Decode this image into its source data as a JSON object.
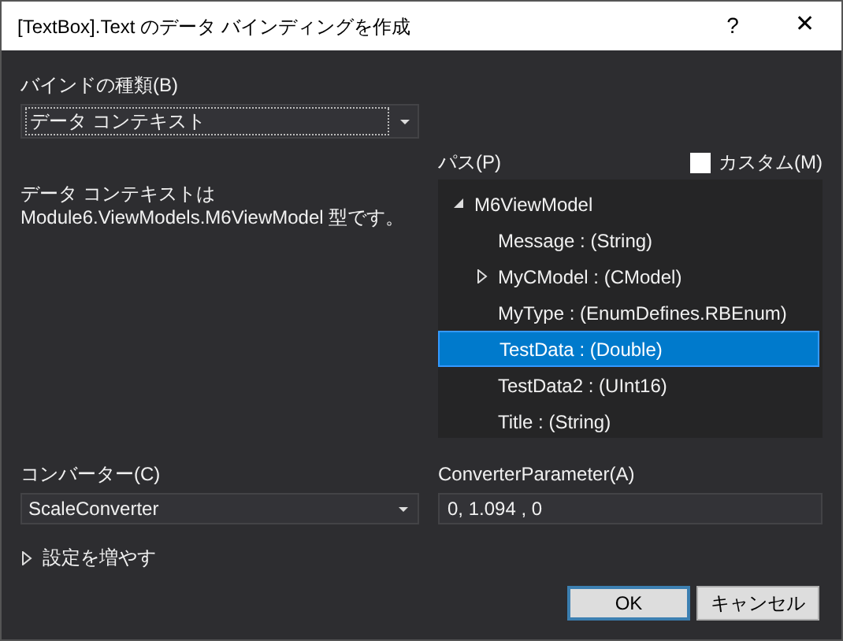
{
  "window": {
    "title": "[TextBox].Text のデータ バインディングを作成",
    "help": "?",
    "close": "✕"
  },
  "binding_type": {
    "label": "バインドの種類(B)",
    "value": "データ コンテキスト"
  },
  "description": "データ コンテキストは\nModule6.ViewModels.M6ViewModel 型です。",
  "path": {
    "label": "パス(P)",
    "custom": {
      "label": "カスタム(M)",
      "checked": false
    },
    "tree": [
      {
        "kind": "group",
        "label": "M6ViewModel",
        "expanded": true,
        "selected": false,
        "children": [
          {
            "kind": "leaf",
            "label": "Message : (String)",
            "selected": false
          },
          {
            "kind": "group",
            "label": "MyCModel : (CModel)",
            "expanded": false,
            "selected": false
          },
          {
            "kind": "leaf",
            "label": "MyType : (EnumDefines.RBEnum)",
            "selected": false
          },
          {
            "kind": "leaf",
            "label": "TestData : (Double)",
            "selected": true
          },
          {
            "kind": "leaf",
            "label": "TestData2 : (UInt16)",
            "selected": false
          },
          {
            "kind": "leaf",
            "label": "Title : (String)",
            "selected": false
          }
        ]
      }
    ]
  },
  "converter": {
    "label": "コンバーター(C)",
    "value": "ScaleConverter"
  },
  "converter_parameter": {
    "label": "ConverterParameter(A)",
    "value": "0, 1.094 , 0"
  },
  "more_settings": {
    "label": "設定を増やす",
    "expanded": false
  },
  "buttons": [
    {
      "label": "OK",
      "default": true
    },
    {
      "label": "キャンセル",
      "default": false
    }
  ]
}
